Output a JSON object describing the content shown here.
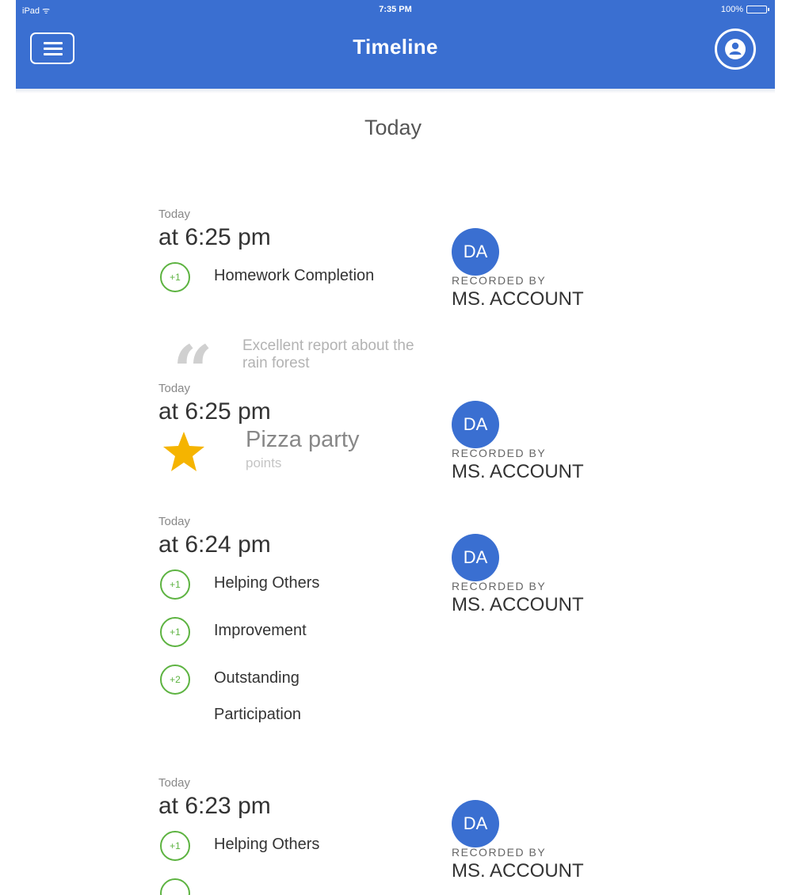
{
  "status_bar": {
    "device": "iPad ᯤ",
    "time": "7:35 PM",
    "battery": "100%"
  },
  "header": {
    "title": "Timeline"
  },
  "section": {
    "title": "Today"
  },
  "entries": [
    {
      "day": "Today",
      "time": "at 6:25 pm",
      "behaviors": [
        {
          "points": "+1",
          "name": "Homework Completion"
        }
      ],
      "recorder": {
        "initials": "DA",
        "label": "RECORDED BY",
        "name": "MS. ACCOUNT"
      },
      "note": "Excellent report about the rain forest"
    },
    {
      "day": "Today",
      "time": "at 6:25 pm",
      "award": {
        "name": "Pizza party",
        "sub": "points",
        "icon": "star-icon",
        "color": "#f5b400"
      },
      "recorder": {
        "initials": "DA",
        "label": "RECORDED BY",
        "name": "MS. ACCOUNT"
      }
    },
    {
      "day": "Today",
      "time": "at 6:24 pm",
      "behaviors": [
        {
          "points": "+1",
          "name": "Helping Others"
        },
        {
          "points": "+1",
          "name": "Improvement"
        },
        {
          "points": "+2",
          "name": "Outstanding Participation"
        }
      ],
      "recorder": {
        "initials": "DA",
        "label": "RECORDED BY",
        "name": "MS. ACCOUNT"
      }
    },
    {
      "day": "Today",
      "time": "at 6:23 pm",
      "behaviors": [
        {
          "points": "+1",
          "name": "Helping Others"
        }
      ],
      "recorder": {
        "initials": "DA",
        "label": "RECORDED BY",
        "name": "MS. ACCOUNT"
      }
    }
  ],
  "colors": {
    "brand": "#3a6fd1",
    "positive": "#5db341",
    "star": "#f5b400"
  }
}
